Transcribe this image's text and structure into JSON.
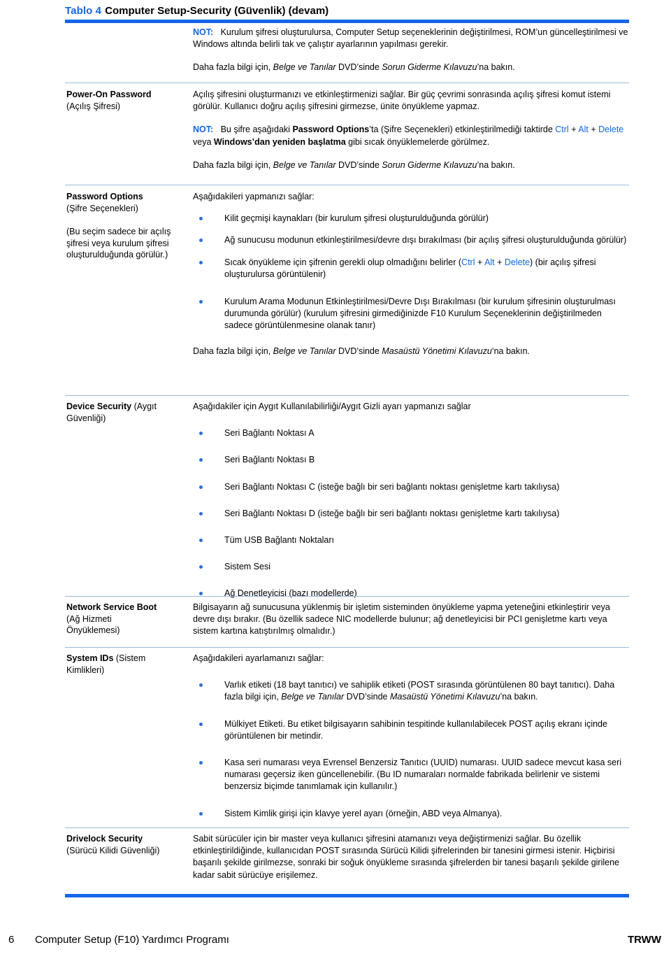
{
  "colors": {
    "accent_blue": "#1565e8",
    "caption_blue": "#1466e0",
    "rule_light": "#9bb8de",
    "bullet_blue": "#2f6fd0"
  },
  "caption": {
    "number": "Tablo 4",
    "title": "Computer Setup-Security (Güvenlik) (devam)"
  },
  "intro_row": {
    "note_label": "NOT:",
    "note_text": "Kurulum şifresi oluşturulursa, Computer Setup seçeneklerinin değiştirilmesi, ROM’un güncelleştirilmesi ve Windows altında belirli tak ve çalıştır ayarlarının yapılması gerekir.",
    "see_also_pre": "Daha fazla bilgi için, ",
    "see_also_doc": "Belge ve Tanılar",
    "see_also_mid": " DVD’sinde ",
    "see_also_guide": "Sorun Giderme Kılavuzu",
    "see_also_post": "’na bakın."
  },
  "rows": [
    {
      "label_bold": "Power-On Password",
      "label_rest": "",
      "label_sub": "(Açılış Şifresi)",
      "paragraphs": [
        "Açılış şifresini oluşturmanızı ve etkinleştirmenizi sağlar. Bir güç çevrimi sonrasında açılış şifresi komut istemi görülür. Kullanıcı doğru açılış şifresini girmezse, ünite önyükleme yapmaz."
      ],
      "note": {
        "label": "NOT:",
        "part1": "Bu şifre aşağıdaki ",
        "bold1": "Password Options",
        "part2": "’ta (Şifre Seçenekleri) etkinleştirilmediği taktirde ",
        "key1": "Ctrl",
        "plus1": " + ",
        "key2": "Alt",
        "plus2": " + ",
        "key3": "Delete",
        "part3": " veya ",
        "bold2": "Windows’dan yeniden başlatma",
        "part4": " gibi sıcak önyüklemelerde görülmez."
      },
      "see_also": {
        "pre": "Daha fazla bilgi için, ",
        "doc": "Belge ve Tanılar",
        "mid": " DVD’sinde ",
        "guide": "Sorun Giderme Kılavuzu",
        "post": "’na bakın."
      }
    },
    {
      "label_bold": "Password Options",
      "label_sub": "(Şifre Seçenekleri)",
      "label_note": "(Bu seçim sadece bir açılış şifresi veya kurulum şifresi oluşturulduğunda görülür.)",
      "intro": "Aşağıdakileri yapmanızı sağlar:",
      "bullets": [
        "Kilit geçmişi kaynakları (bir kurulum şifresi oluşturulduğunda görülür)",
        "Ağ sunucusu modunun etkinleştirilmesi/devre dışı bırakılması (bir açılış şifresi oluşturulduğunda görülür)",
        "Sıcak önyükleme için şifrenin gerekli olup olmadığını belirler (Ctrl + Alt + Delete) (bir açılış şifresi oluşturulursa görüntülenir)",
        "Kurulum Arama Modunun Etkinleştirilmesi/Devre Dışı Bırakılması (bir kurulum şifresinin oluşturulması durumunda görülür) (kurulum şifresini girmediğinizde F10 Kurulum Seçeneklerinin değiştirilmeden sadece görüntülenmesine olanak tanır)"
      ],
      "bullet3_parts": {
        "pre": "Sıcak önyükleme için şifrenin gerekli olup olmadığını belirler (",
        "key1": "Ctrl",
        "plus1": " + ",
        "key2": "Alt",
        "plus2": " + ",
        "key3": "Delete",
        "post": ") (bir açılış şifresi oluşturulursa görüntülenir)"
      },
      "see_also": {
        "pre": "Daha fazla bilgi için, ",
        "doc": "Belge ve Tanılar",
        "mid": " DVD’sinde ",
        "guide": "Masaüstü Yönetimi Kılavuzu",
        "post": "’na bakın."
      }
    },
    {
      "label_bold": "Device Security",
      "label_rest": " (Aygıt",
      "label_sub": "Güvenliği)",
      "intro": "Aşağıdakiler için Aygıt Kullanılabilirliği/Aygıt Gizli ayarı yapmanızı sağlar",
      "bullets": [
        "Seri Bağlantı Noktası A",
        "Seri Bağlantı Noktası B",
        "Seri Bağlantı Noktası C (isteğe bağlı bir seri bağlantı noktası genişletme kartı takılıysa)",
        "Seri Bağlantı Noktası D (isteğe bağlı bir seri bağlantı noktası genişletme kartı takılıysa)",
        "Tüm USB Bağlantı Noktaları",
        "Sistem Sesi",
        "Ağ Denetleyicisi (bazı modellerde)"
      ]
    },
    {
      "label_bold": "Network Service Boot",
      "label_sub": "(Ağ Hizmeti",
      "label_sub2": "Önyüklemesi)",
      "paragraphs": [
        "Bilgisayarın ağ sunucusuna yüklenmiş bir işletim sisteminden önyükleme yapma yeteneğini etkinleştirir veya devre dışı bırakır. (Bu özellik sadece NIC modellerde bulunur; ağ denetleyicisi bir PCI genişletme kartı veya sistem kartına katıştırılmış olmalıdır.)"
      ]
    },
    {
      "label_bold": "System IDs",
      "label_rest": " (Sistem",
      "label_sub": "Kimlikleri)",
      "intro": "Aşağıdakileri ayarlamanızı sağlar:",
      "bullets": [
        "Varlık etiketi (18 bayt tanıtıcı) ve sahiplik etiketi (POST sırasında görüntülenen 80 bayt tanıtıcı). Daha fazla bilgi için, Belge ve Tanılar DVD’sinde Masaüstü Yönetimi Kılavuzu’na bakın.",
        "Mülkiyet Etiketi. Bu etiket bilgisayarın sahibinin tespitinde kullanılabilecek POST açılış ekranı içinde görüntülenen bir metindir.",
        "Kasa seri numarası veya Evrensel Benzersiz Tanıtıcı (UUID) numarası. UUID sadece mevcut kasa seri numarası geçersiz iken güncellenebilir. (Bu ID numaraları normalde fabrikada belirlenir ve sistemi benzersiz biçimde tanımlamak için kullanılır.)",
        "Sistem Kimlik girişi için klavye yerel ayarı (örneğin, ABD veya Almanya)."
      ],
      "bullet1_parts": {
        "pre": "Varlık etiketi (18 bayt tanıtıcı) ve sahiplik etiketi (POST sırasında görüntülenen 80 bayt tanıtıcı). Daha fazla bilgi için, ",
        "doc": "Belge ve Tanılar",
        "mid": " DVD’sinde ",
        "guide": "Masaüstü Yönetimi Kılavuzu",
        "post": "’na bakın."
      }
    },
    {
      "label_bold": "Drivelock Security",
      "label_sub": "(Sürücü Kilidi Güvenliği)",
      "paragraphs": [
        "Sabit sürücüler için bir master veya kullanıcı şifresini atamanızı veya değiştirmenizi sağlar. Bu özellik etkinleştirildiğinde, kullanıcıdan POST sırasında Sürücü Kilidi şifrelerinden bir tanesini girmesi istenir. Hiçbirisi başarılı şekilde girilmezse, sonraki bir soğuk önyükleme sırasında şifrelerden bir tanesi başarılı şekilde girilene kadar sabit sürücüye erişilemez."
      ]
    }
  ],
  "footer": {
    "page_number": "6",
    "title": "Computer Setup (F10) Yardımcı Programı",
    "right": "TRWW"
  }
}
